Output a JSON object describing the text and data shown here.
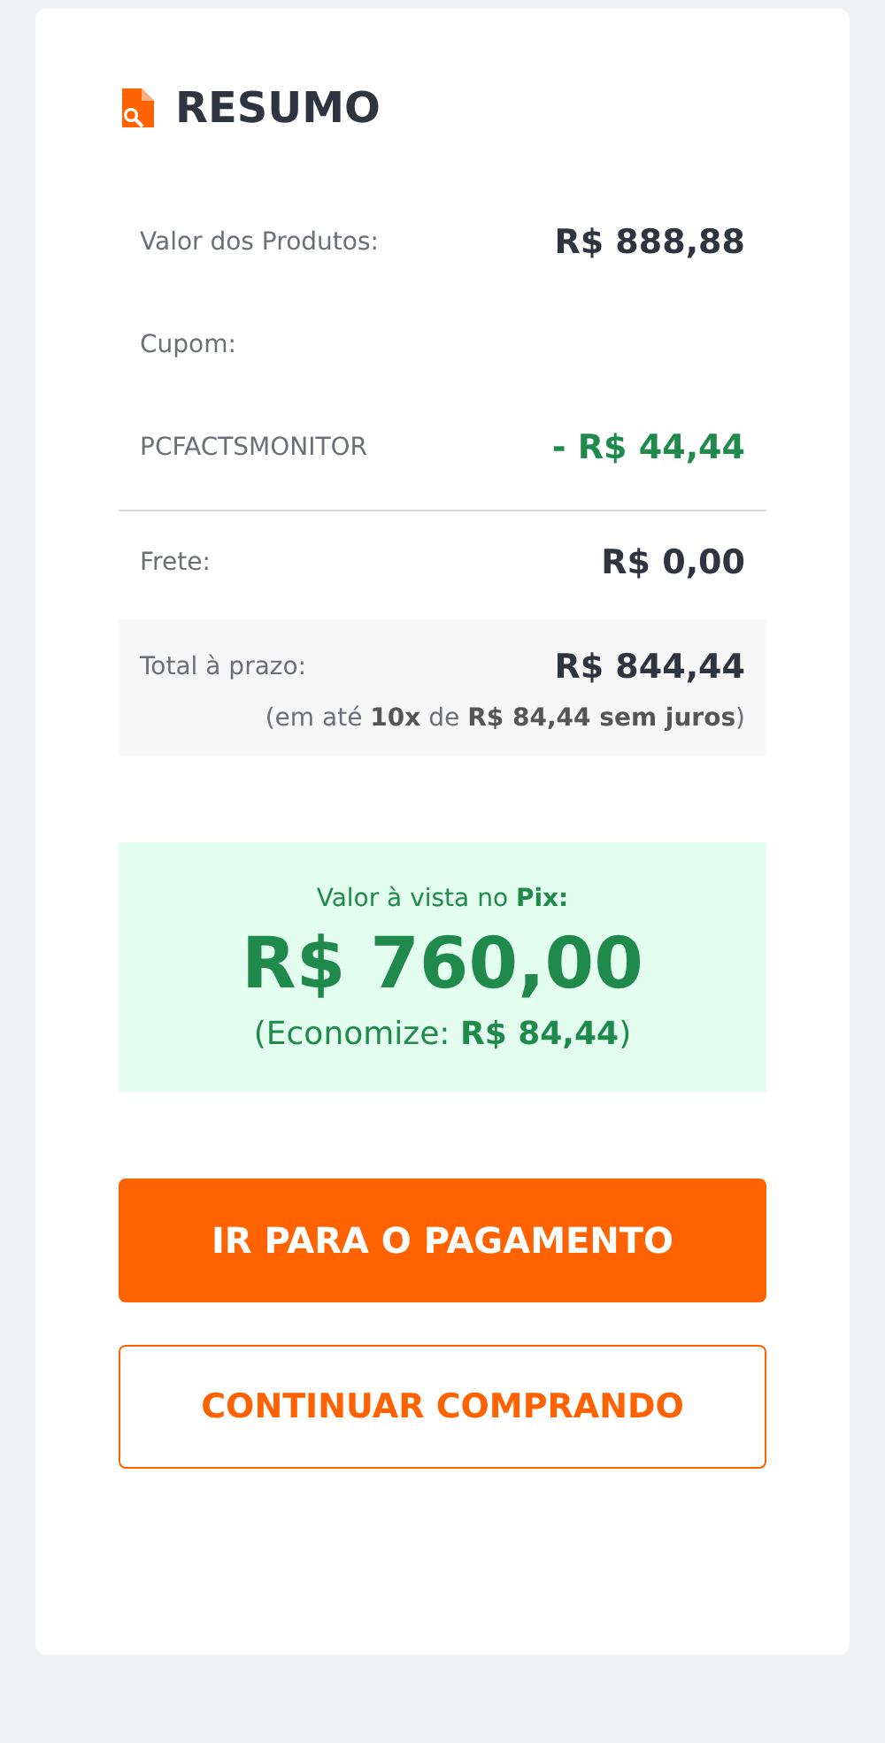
{
  "summary": {
    "title": "RESUMO",
    "lines": [
      {
        "label": "Valor dos Produtos:",
        "value": "R$ 888,88",
        "kind": "amount"
      },
      {
        "label": "Cupom:",
        "kind": "heading"
      },
      {
        "label": "PCFACTSMONITOR",
        "value": "- R$ 44,44",
        "kind": "discount"
      }
    ],
    "shipping": {
      "label": "Frete:",
      "value": "R$ 0,00"
    },
    "total": {
      "label": "Total à prazo:",
      "value": "R$ 844,44",
      "note": "(em até **10x** de **R$ 84,44 sem juros**)"
    },
    "pix": {
      "caption": "Valor à vista no **Pix:**",
      "amount": "R$ 760,00",
      "savings": "(Economize: **R$ 84,44**)"
    },
    "buttons": [
      {
        "label": "IR PARA O PAGAMENTO",
        "kind": "primary"
      },
      {
        "label": "CONTINUAR COMPRANDO",
        "kind": "secondary"
      }
    ]
  }
}
